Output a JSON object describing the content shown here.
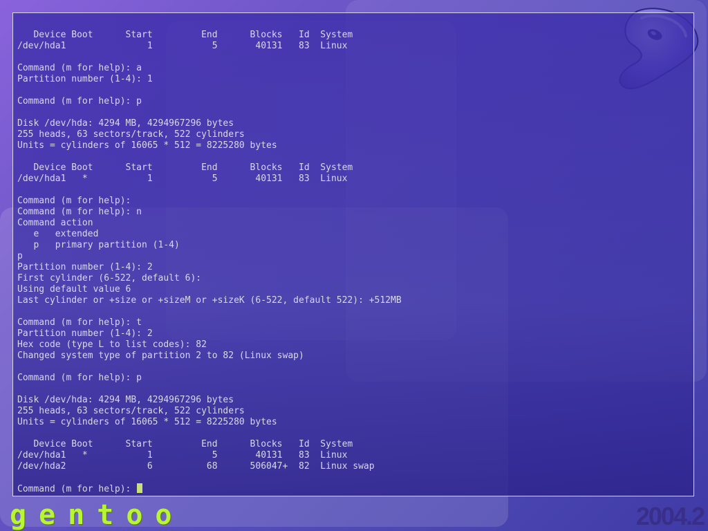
{
  "terminal": {
    "lines": [
      "   Device Boot      Start         End      Blocks   Id  System",
      "/dev/hda1               1           5       40131   83  Linux",
      "",
      "Command (m for help): a",
      "Partition number (1-4): 1",
      "",
      "Command (m for help): p",
      "",
      "Disk /dev/hda: 4294 MB, 4294967296 bytes",
      "255 heads, 63 sectors/track, 522 cylinders",
      "Units = cylinders of 16065 * 512 = 8225280 bytes",
      "",
      "   Device Boot      Start         End      Blocks   Id  System",
      "/dev/hda1   *           1           5       40131   83  Linux",
      "",
      "Command (m for help):",
      "Command (m for help): n",
      "Command action",
      "   e   extended",
      "   p   primary partition (1-4)",
      "p",
      "Partition number (1-4): 2",
      "First cylinder (6-522, default 6):",
      "Using default value 6",
      "Last cylinder or +size or +sizeM or +sizeK (6-522, default 522): +512MB",
      "",
      "Command (m for help): t",
      "Partition number (1-4): 2",
      "Hex code (type L to list codes): 82",
      "Changed system type of partition 2 to 82 (Linux swap)",
      "",
      "Command (m for help): p",
      "",
      "Disk /dev/hda: 4294 MB, 4294967296 bytes",
      "255 heads, 63 sectors/track, 522 cylinders",
      "Units = cylinders of 16065 * 512 = 8225280 bytes",
      "",
      "   Device Boot      Start         End      Blocks   Id  System",
      "/dev/hda1   *           1           5       40131   83  Linux",
      "/dev/hda2               6          68      506047+  82  Linux swap",
      ""
    ],
    "prompt": "Command (m for help): "
  },
  "branding": {
    "wordmark": "gentoo",
    "version": "2004.2"
  },
  "colors": {
    "terminal_text": "#d9d9e8",
    "cursor": "#c8e07a",
    "wordmark": "#b8f536",
    "version": "#3a2f88"
  },
  "icons": {
    "logo": "gentoo-logo-icon"
  }
}
